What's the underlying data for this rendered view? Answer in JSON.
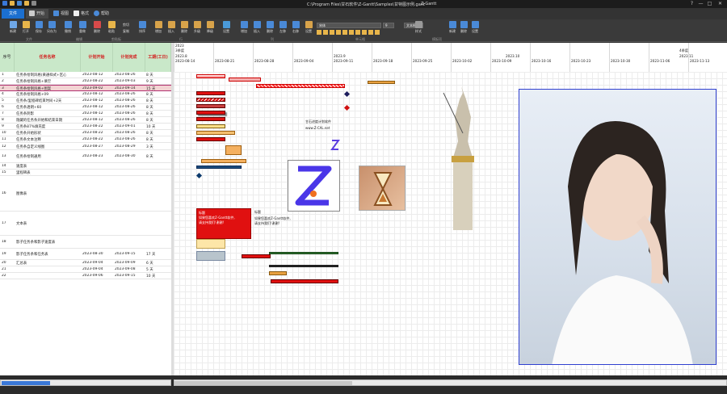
{
  "window": {
    "title": "C:\\Program Files\\甘石软件\\Z-Gantt\\Samples\\甘特图示例.gant",
    "app_name": "Z-Gantt",
    "controls": [
      "?",
      "—",
      "□",
      "✕"
    ]
  },
  "tabs": [
    {
      "label": "文件"
    },
    {
      "label": "开始"
    },
    {
      "label": "视图"
    },
    {
      "label": "格式"
    },
    {
      "label": "帮助"
    }
  ],
  "ribbon": {
    "buttons": [
      {
        "label": "新建",
        "color": "#6fa8e8"
      },
      {
        "label": "打开",
        "color": "#e8b54a"
      },
      {
        "label": "保存",
        "color": "#4a8ad8"
      },
      {
        "label": "另存为",
        "color": "#4a8ad8"
      },
      {
        "label": "撤销",
        "color": "#4a8ad8"
      },
      {
        "label": "重做",
        "color": "#4a8ad8"
      },
      {
        "label": "删除",
        "color": "#d84a4a"
      },
      {
        "label": "粘贴",
        "color": "#e8b54a"
      },
      {
        "label": "排序",
        "color": "#4a8ad8"
      },
      {
        "label": "增加",
        "color": "#d8a34a"
      },
      {
        "label": "插入",
        "color": "#d8a34a"
      },
      {
        "label": "删除",
        "color": "#d8a34a"
      },
      {
        "label": "升级",
        "color": "#d8a34a"
      },
      {
        "label": "降级",
        "color": "#d8a34a"
      },
      {
        "label": "设置",
        "color": "#4a9ad8"
      },
      {
        "label": "增加",
        "color": "#4a8ad8"
      },
      {
        "label": "插入",
        "color": "#4a8ad8"
      },
      {
        "label": "删除",
        "color": "#4a8ad8"
      },
      {
        "label": "左移",
        "color": "#4a8ad8"
      },
      {
        "label": "右移",
        "color": "#4a8ad8"
      },
      {
        "label": "设置",
        "color": "#d8a34a"
      },
      {
        "label": "样式",
        "color": "#999999"
      },
      {
        "label": "新建",
        "color": "#4a8ad8"
      },
      {
        "label": "删除",
        "color": "#4a8ad8"
      },
      {
        "label": "设置",
        "color": "#4a8ad8"
      }
    ],
    "small_buttons": [
      "剪切",
      "复制"
    ],
    "groups": [
      "文件",
      "编辑",
      "剪贴板",
      "行",
      "列",
      "单元格",
      "模板项"
    ],
    "font_combo": "宋体",
    "size_combo": "9",
    "style_combo": "文本框"
  },
  "table": {
    "headers": [
      "序号",
      "任务名称",
      "计划开始",
      "计划完成",
      "工期(工日)"
    ],
    "rows": [
      {
        "id": "1",
        "name": "任务条绘制风格(黄通样式+区心",
        "start": "2023-08-12",
        "end": "2023-08-26",
        "dur": "8 天"
      },
      {
        "id": "2",
        "name": "任务条绘制风格+填空",
        "start": "2023-08-22",
        "end": "2023-09-03",
        "dur": "9 天"
      },
      {
        "id": "3",
        "name": "任务条绘制风格+图案",
        "start": "2023-09-02",
        "end": "2023-09-14",
        "dur": "15 天"
      },
      {
        "id": "4",
        "name": "任务条绘制风格+09",
        "start": "2023-08-12",
        "end": "2023-08-26",
        "dur": "8 天"
      },
      {
        "id": "5",
        "name": "任务条/里程碑结束时间+2天",
        "start": "2023-08-12",
        "end": "2023-08-26",
        "dur": "8 天"
      },
      {
        "id": "6",
        "name": "任务条透明+60",
        "start": "2023-08-12",
        "end": "2023-08-26",
        "dur": "8 天"
      },
      {
        "id": "7",
        "name": "任务条阴影",
        "start": "2023-08-12",
        "end": "2023-08-26",
        "dur": "8 天"
      },
      {
        "id": "8",
        "name": "隐藏的任务条开始和结束日期",
        "start": "2023-08-12",
        "end": "2023-08-26",
        "dur": "8 天"
      },
      {
        "id": "9",
        "name": "任务条87%填充度",
        "start": "2023-08-22",
        "end": "2023-09-01",
        "dur": "10 天"
      },
      {
        "id": "10",
        "name": "任务条开始形状",
        "start": "2023-08-22",
        "end": "2023-08-26",
        "dur": "8 天"
      },
      {
        "id": "11",
        "name": "任务条文本注释",
        "start": "2023-08-22",
        "end": "2023-08-26",
        "dur": "8 天"
      },
      {
        "id": "12",
        "name": "任务条自定义线图",
        "start": "2023-08-27",
        "end": "2023-08-29",
        "dur": "3 天"
      },
      {
        "id": "13",
        "name": "任务条绘制通用",
        "start": "2023-08-23",
        "end": "2023-08-30",
        "dur": "8 天"
      },
      {
        "id": "14",
        "name": "速度表",
        "start": "",
        "end": "",
        "dur": ""
      },
      {
        "id": "15",
        "name": "里程碑表",
        "start": "",
        "end": "",
        "dur": ""
      },
      {
        "id": "16",
        "name": "图像表",
        "start": "",
        "end": "",
        "dur": ""
      },
      {
        "id": "17",
        "name": "文本表",
        "start": "",
        "end": "",
        "dur": ""
      },
      {
        "id": "18",
        "name": "影子任务条和影子速度表",
        "start": "",
        "end": "",
        "dur": ""
      },
      {
        "id": "19",
        "name": "影子任务条和任务表",
        "start": "2023-08-30",
        "end": "2023-09-15",
        "dur": "17 天"
      },
      {
        "id": "20",
        "name": "汇总表",
        "start": "2023-09-04",
        "end": "2023-09-09",
        "dur": "6 天"
      },
      {
        "id": "21",
        "name": "",
        "start": "2023-09-04",
        "end": "2023-09-08",
        "dur": "5 天"
      },
      {
        "id": "22",
        "name": "",
        "start": "2023-09-06",
        "end": "2023-09-15",
        "dur": "10 天"
      }
    ]
  },
  "timeline": {
    "year": "2023",
    "quarters": [
      "3季度",
      "4季度"
    ],
    "months": [
      "2023.8",
      "2023.9",
      "2023.10",
      "2023.11"
    ],
    "weeks": [
      "2023-08-14",
      "2023-08-21",
      "2023-08-28",
      "2023-09-04",
      "2023-09-11",
      "2023-09-18",
      "2023-09-25",
      "2023-10-02",
      "2023-10-09",
      "2023-10-16",
      "2023-10-23",
      "2023-10-30",
      "2023-11-06",
      "2023-11-13",
      "2023-11-2"
    ]
  },
  "annotations": {
    "note_line1": "甘石进度计划软件",
    "note_line2": "www.Z-CAL.net",
    "callout_title": "标题",
    "callout_body": "如果您喜欢Z-Gantt软件,\n请支持我们!谢谢!",
    "red_box_title": "标题",
    "red_box_body": "如果您喜欢Z-Gantt软件,\n请支持我们!谢谢!"
  },
  "colors": {
    "accent": "#1b6fd0",
    "header_bg": "#c9e8c9",
    "header_text": "#d32020",
    "bar_red": "#e01010",
    "bar_orange": "#e8a040",
    "bar_green": "#2c8a2c",
    "selection": "#b0306f"
  }
}
